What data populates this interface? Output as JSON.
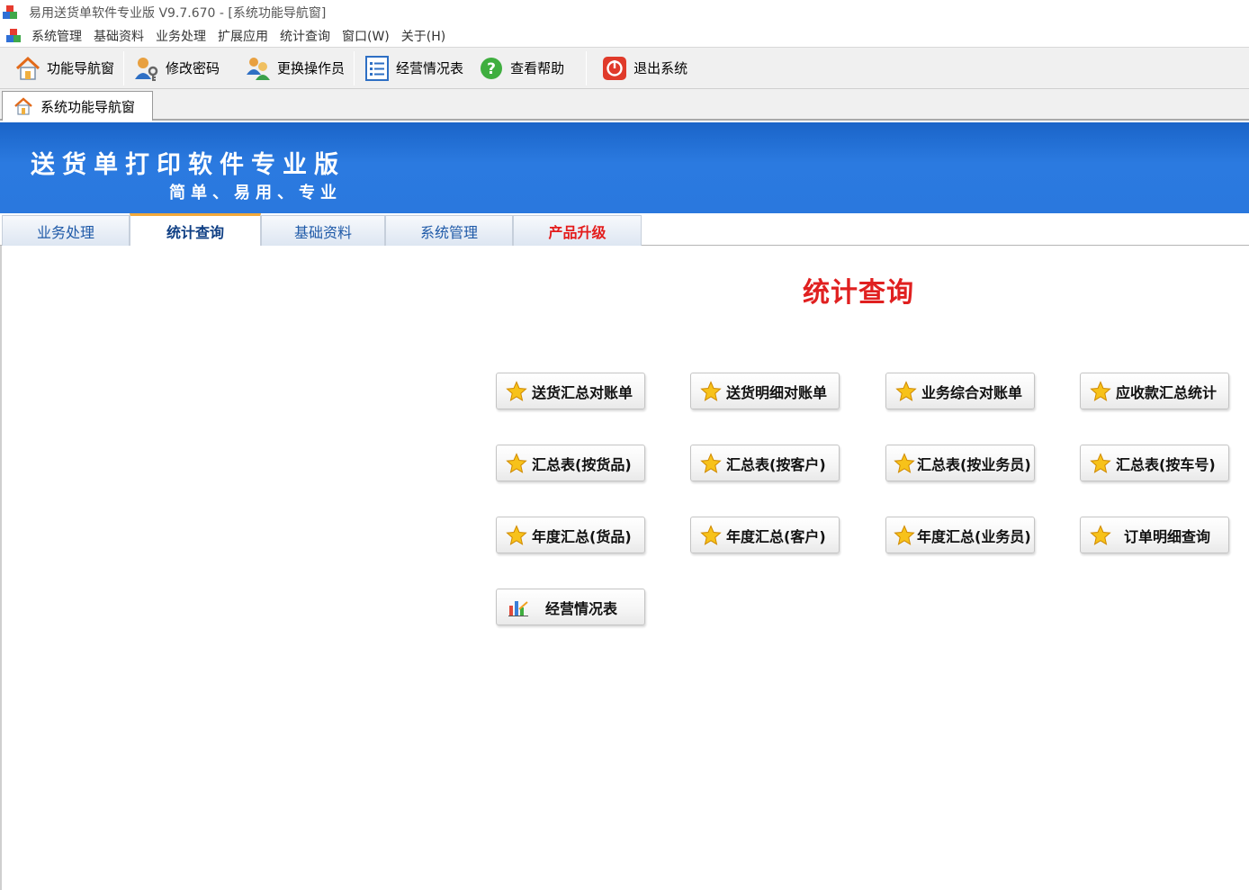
{
  "window": {
    "title": "易用送货单软件专业版 V9.7.670 - [系统功能导航窗]"
  },
  "menu": [
    {
      "label": "系统管理"
    },
    {
      "label": "基础资料"
    },
    {
      "label": "业务处理"
    },
    {
      "label": "扩展应用"
    },
    {
      "label": "统计查询"
    },
    {
      "label": "窗口(W)"
    },
    {
      "label": "关于(H)"
    }
  ],
  "toolbar": {
    "nav": "功能导航窗",
    "password": "修改密码",
    "switch_user": "更换操作员",
    "report": "经营情况表",
    "help": "查看帮助",
    "exit": "退出系统"
  },
  "doc_tab": {
    "label": "系统功能导航窗"
  },
  "banner": {
    "title": "送货单打印软件专业版",
    "subtitle": "简单、易用、专业"
  },
  "nav_tabs": [
    {
      "label": "业务处理"
    },
    {
      "label": "统计查询",
      "active": true
    },
    {
      "label": "基础资料"
    },
    {
      "label": "系统管理"
    },
    {
      "label": "产品升级"
    }
  ],
  "section": {
    "title": "统计查询"
  },
  "functions": [
    {
      "label": "送货汇总对账单",
      "icon": "star-icon"
    },
    {
      "label": "送货明细对账单",
      "icon": "star-icon"
    },
    {
      "label": "业务综合对账单",
      "icon": "star-icon"
    },
    {
      "label": "应收款汇总统计",
      "icon": "star-icon"
    },
    {
      "label": "汇总表(按货品)",
      "icon": "star-icon"
    },
    {
      "label": "汇总表(按客户)",
      "icon": "star-icon"
    },
    {
      "label": "汇总表(按业务员)",
      "icon": "star-icon"
    },
    {
      "label": "汇总表(按车号)",
      "icon": "star-icon"
    },
    {
      "label": "年度汇总(货品)",
      "icon": "star-icon"
    },
    {
      "label": "年度汇总(客户)",
      "icon": "star-icon"
    },
    {
      "label": "年度汇总(业务员)",
      "icon": "star-icon"
    },
    {
      "label": "订单明细查询",
      "icon": "star-icon"
    },
    {
      "label": "经营情况表",
      "icon": "bar-chart-icon"
    }
  ],
  "colors": {
    "banner_blue": "#2a78de",
    "section_title_red": "#e02020",
    "upgrade_red": "#e41c1c",
    "active_tab_accent": "#f2a93b"
  }
}
